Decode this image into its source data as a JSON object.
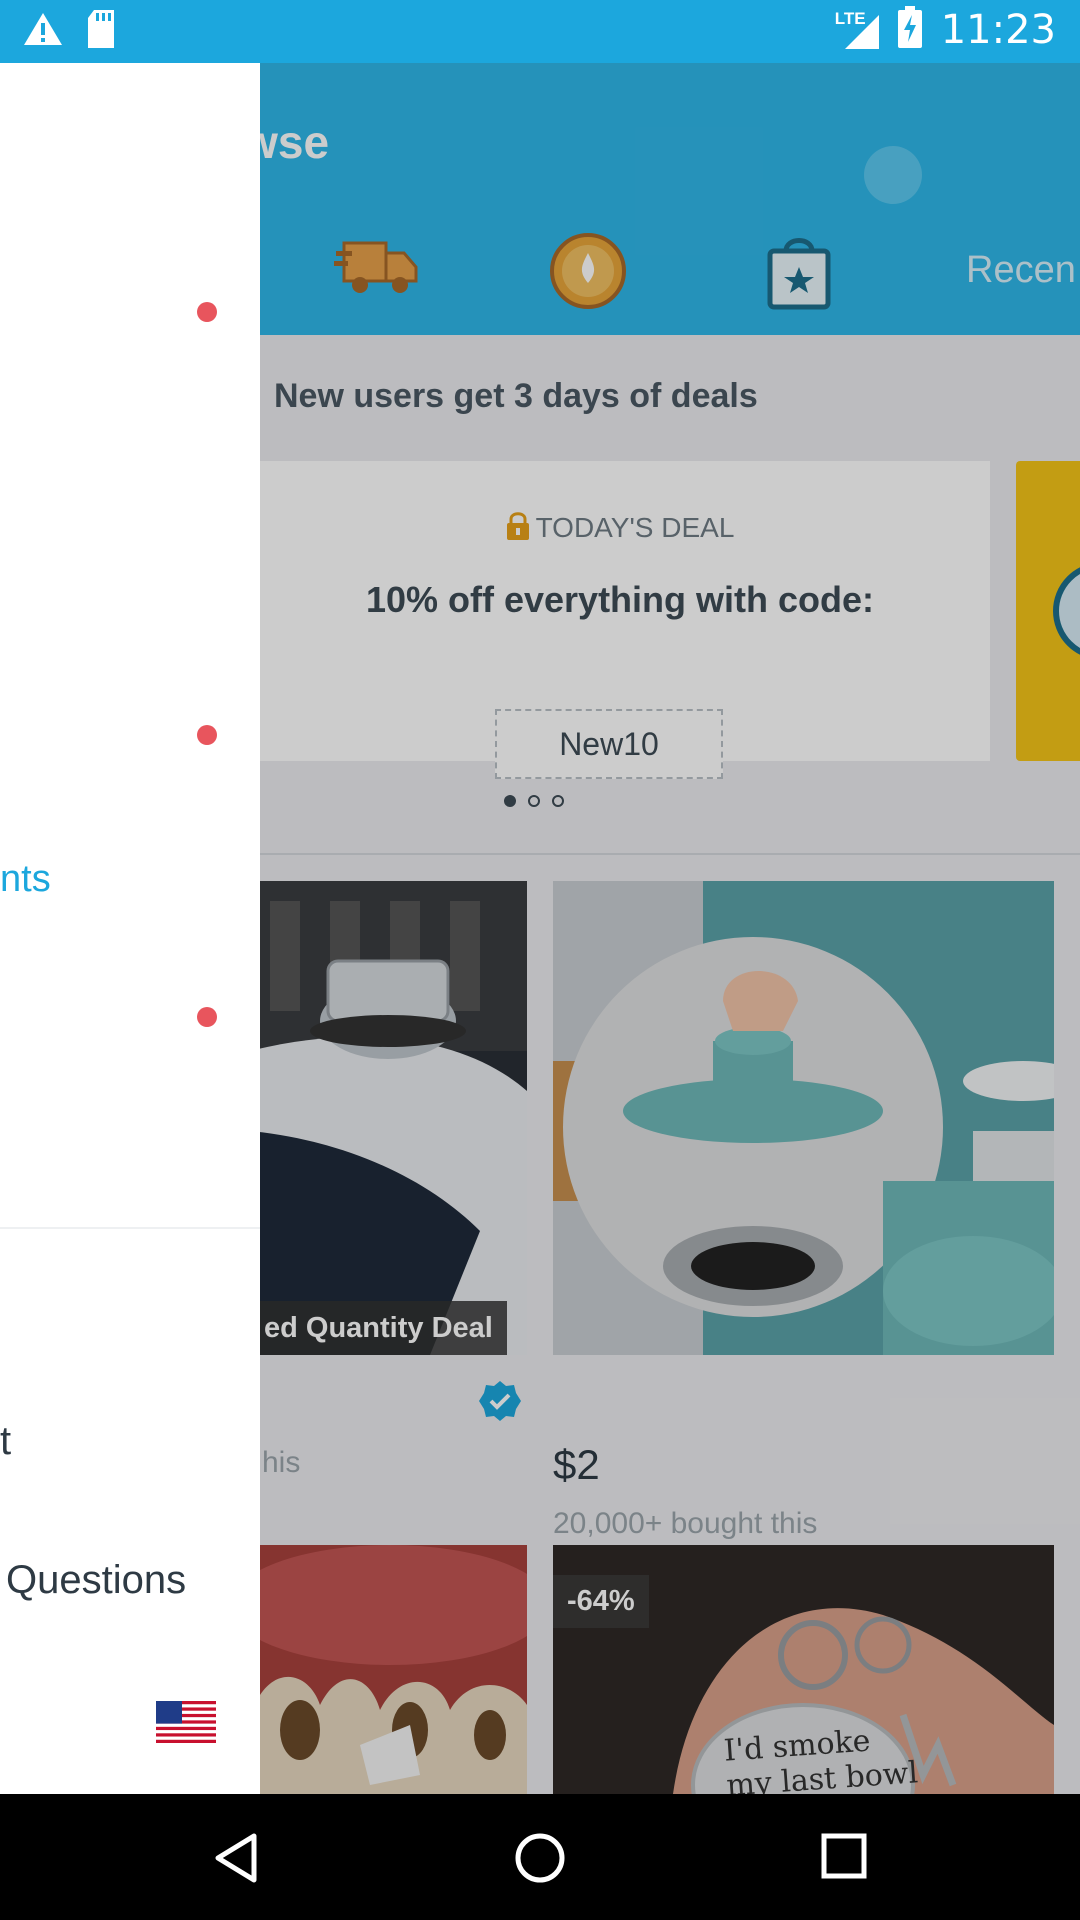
{
  "status_bar": {
    "time": "11:23",
    "network": "LTE",
    "icons": [
      "warning-icon",
      "sd-card-icon",
      "signal-icon",
      "battery-charging-icon"
    ]
  },
  "header": {
    "title": "owse",
    "tabs": [
      "shipping-truck-icon",
      "gold-coin-icon",
      "shopping-bag-star-icon"
    ],
    "recent_tab_label": "Recen"
  },
  "promo": {
    "heading": "New users get 3 days of deals",
    "deal_label": "TODAY'S DEAL",
    "deal_title": "10% off everything with code:",
    "deal_code": "New10",
    "carousel_pages": 3,
    "carousel_active": 0
  },
  "products": [
    {
      "badge": "ed Quantity Deal",
      "price": "",
      "bought": "his",
      "verified": true
    },
    {
      "badge": "",
      "price": "$2",
      "bought": "20,000+ bought this"
    },
    {
      "badge": "",
      "price": "",
      "bought": ""
    },
    {
      "badge": "-64%",
      "price": "",
      "bought": ""
    }
  ],
  "drawer": {
    "highlighted_item": "nts",
    "item_t": "t",
    "item_questions": "Questions",
    "flag": "us-flag-icon"
  },
  "nav_bar": [
    "back-icon",
    "home-icon",
    "recents-icon"
  ],
  "colors": {
    "brand": "#2fb7e9",
    "status_bar": "#1ca7dd",
    "notify_dot": "#e8555d"
  }
}
